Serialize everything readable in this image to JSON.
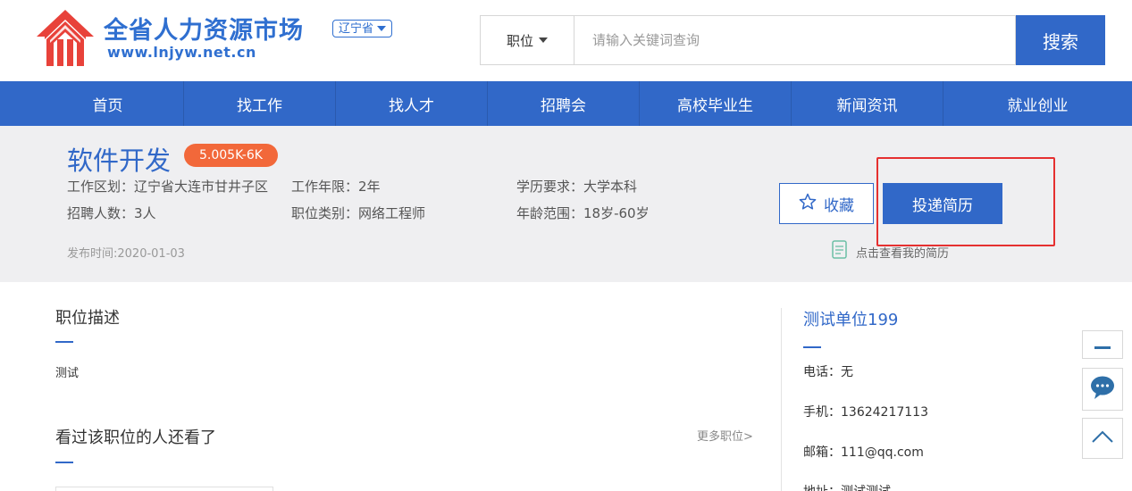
{
  "header": {
    "site_name": "全省人力资源市场",
    "site_url": "www.lnjyw.net.cn",
    "region": "辽宁省"
  },
  "search": {
    "type_label": "职位",
    "placeholder": "请输入关键词查询",
    "button_label": "搜索"
  },
  "nav": {
    "items": [
      "首页",
      "找工作",
      "找人才",
      "招聘会",
      "高校毕业生",
      "新闻资讯",
      "就业创业"
    ]
  },
  "job": {
    "title": "软件开发",
    "salary": "5.005K-6K",
    "district": "工作区划：辽宁省大连市甘井子区",
    "years": "工作年限：2年",
    "education": "学历要求：大学本科",
    "headcount": "招聘人数：3人",
    "category": "职位类别：网络工程师",
    "age": "年龄范围：18岁-60岁",
    "posted": "发布时间:2020-01-03",
    "favorite_label": "收藏",
    "apply_label": "投递简历",
    "view_resume_label": "点击查看我的简历"
  },
  "description": {
    "title": "职位描述",
    "text": "测试"
  },
  "related": {
    "title": "看过该职位的人还看了",
    "more_label": "更多职位>"
  },
  "company": {
    "name": "测试单位199",
    "phone": "电话：无",
    "mobile": "手机：13624217113",
    "email": "邮箱：111@qq.com",
    "address": "地址：测试测试"
  },
  "colors": {
    "brand": "#3168c8",
    "salary_badge": "#f2683a",
    "logo_red": "#e8423a",
    "highlight": "#e53030"
  }
}
